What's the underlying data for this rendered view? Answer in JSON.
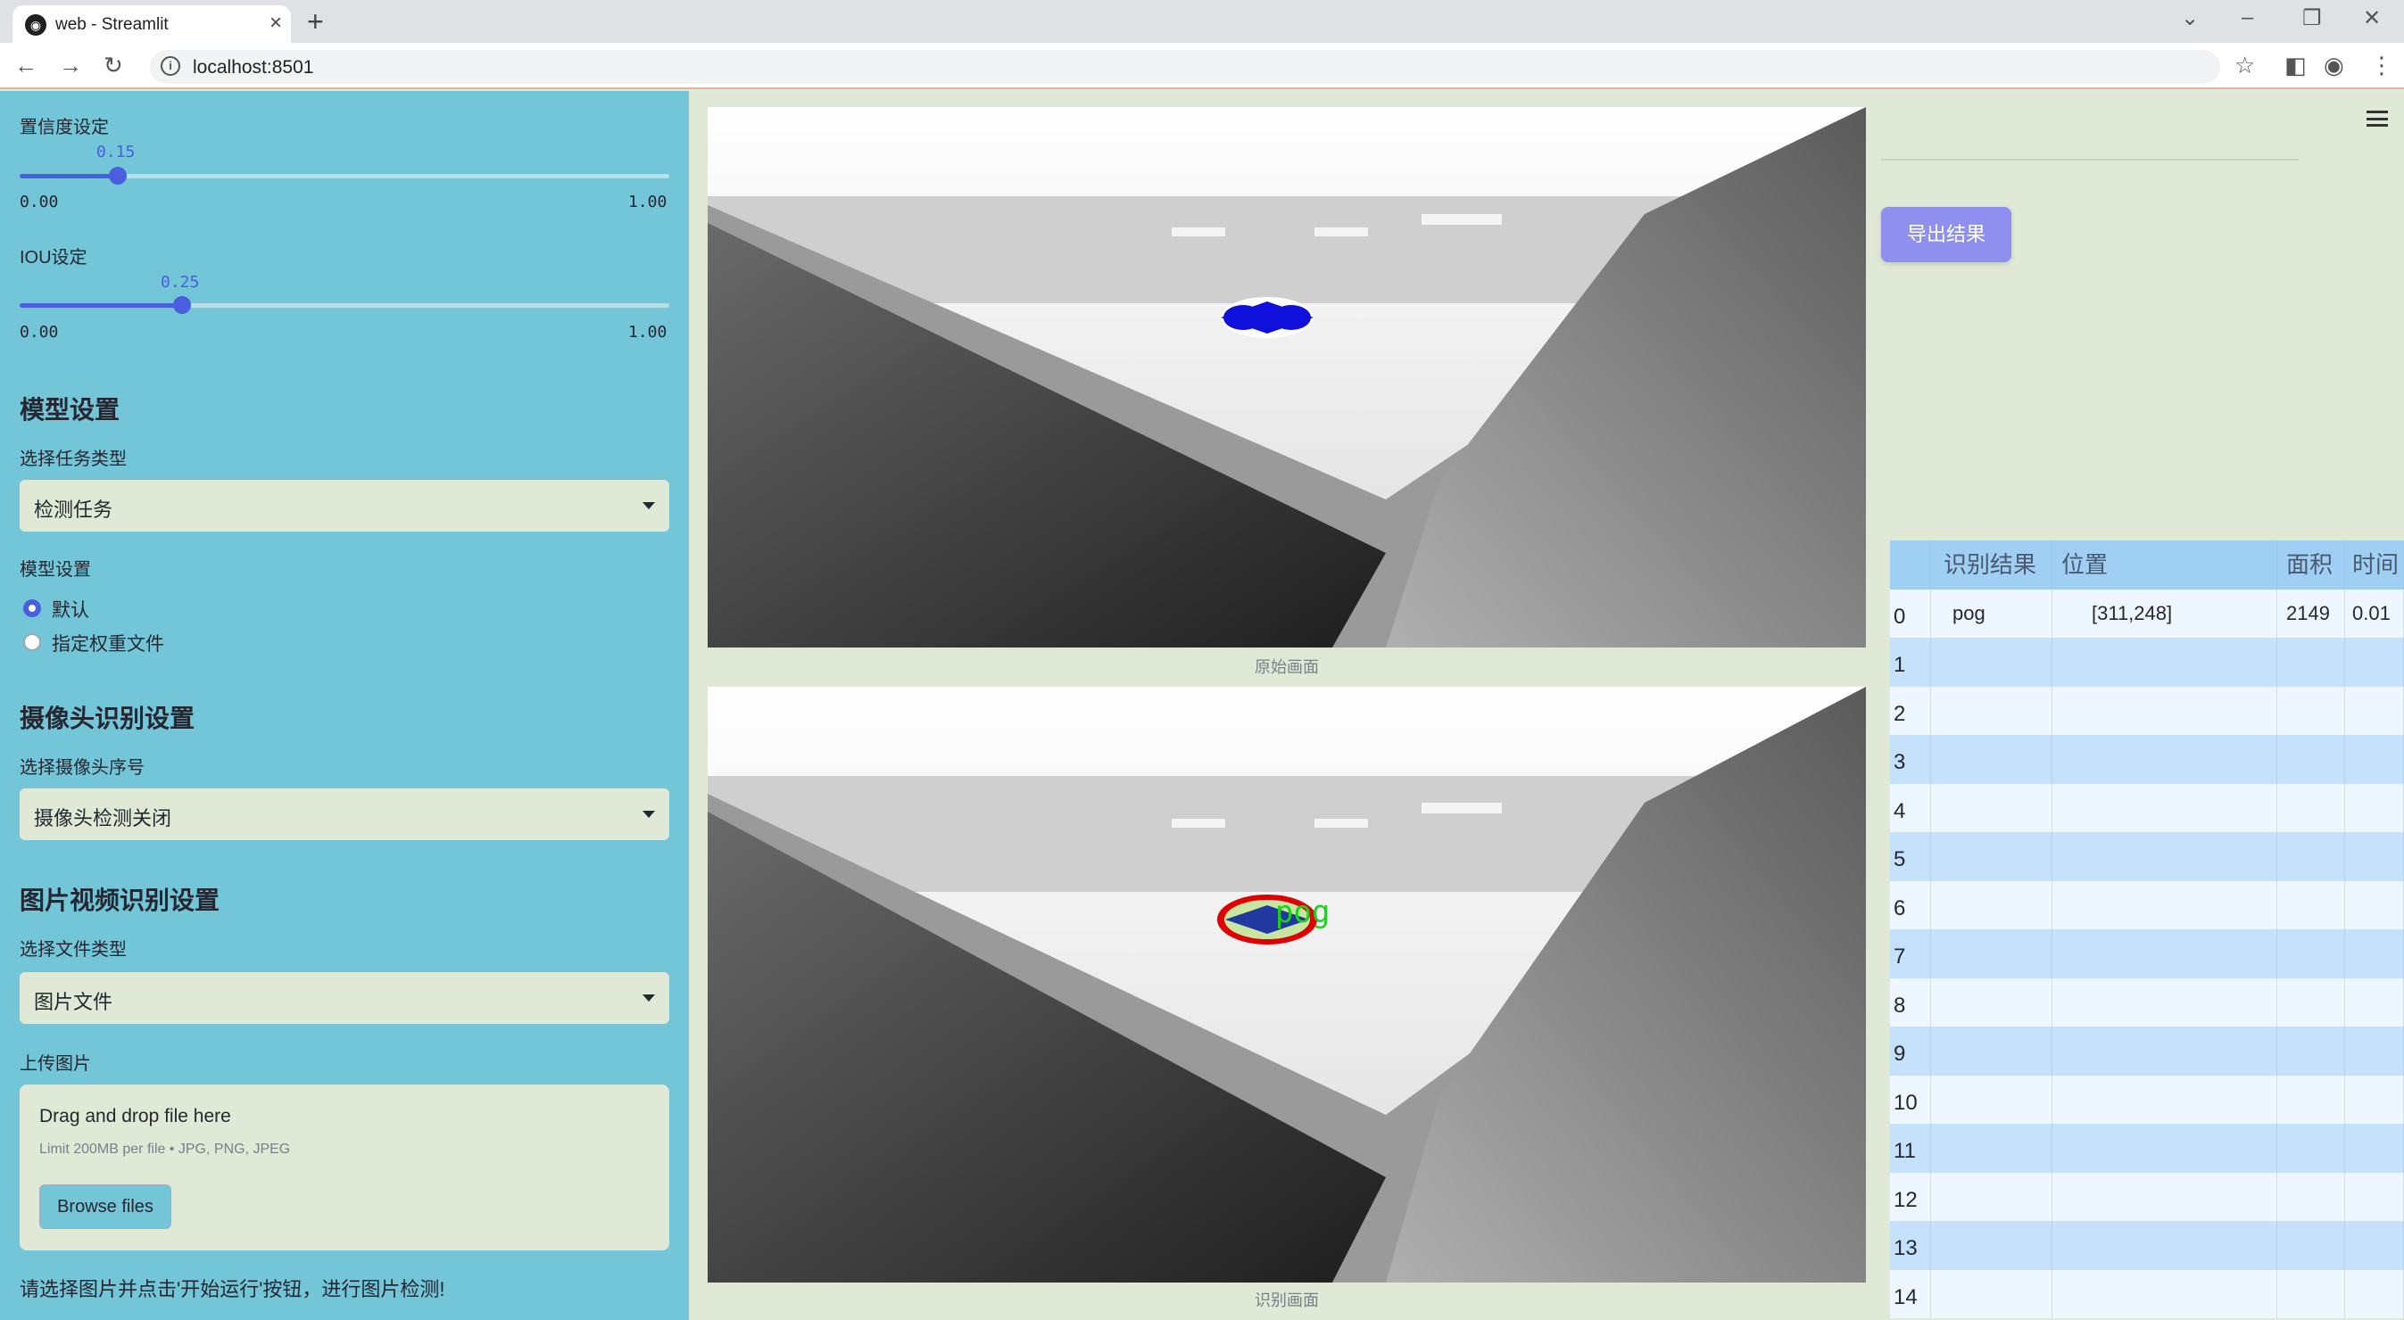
{
  "browser": {
    "tab_title": "web - Streamlit",
    "url": "localhost:8501"
  },
  "sidebar": {
    "confidence": {
      "label": "置信度设定",
      "value": "0.15",
      "min": "0.00",
      "max": "1.00",
      "fraction": 0.15
    },
    "iou": {
      "label": "IOU设定",
      "value": "0.25",
      "min": "0.00",
      "max": "1.00",
      "fraction": 0.25
    },
    "model_heading": "模型设置",
    "task_label": "选择任务类型",
    "task_value": "检测任务",
    "model_label": "模型设置",
    "radio_default": "默认",
    "radio_custom": "指定权重文件",
    "camera_heading": "摄像头识别设置",
    "camera_label": "选择摄像头序号",
    "camera_value": "摄像头检测关闭",
    "media_heading": "图片视频识别设置",
    "filetype_label": "选择文件类型",
    "filetype_value": "图片文件",
    "upload_label": "上传图片",
    "upload_title": "Drag and drop file here",
    "upload_limit": "Limit 200MB per file • JPG, PNG, JPEG",
    "browse_label": "Browse files",
    "hint": "请选择图片并点击'开始运行'按钮，进行图片检测!"
  },
  "main": {
    "caption_original": "原始画面",
    "caption_detected": "识别画面",
    "detection_label": "pog"
  },
  "right": {
    "export_label": "导出结果",
    "table": {
      "headers": [
        "",
        "识别结果",
        "位置",
        "面积",
        "时间"
      ],
      "row0": {
        "index": "0",
        "result": "pog",
        "position": "[311,248]",
        "area": "2149",
        "time": "0.01"
      },
      "indices": [
        "1",
        "2",
        "3",
        "4",
        "5",
        "6",
        "7",
        "8",
        "9",
        "10",
        "11",
        "12",
        "13",
        "14"
      ]
    }
  },
  "colors": {
    "sidebar_bg": "#73c5d8",
    "main_bg": "#dfe9d6",
    "accent": "#4a5fe0",
    "export_btn": "#8f8ff0",
    "table_header": "#9fd0f4"
  }
}
